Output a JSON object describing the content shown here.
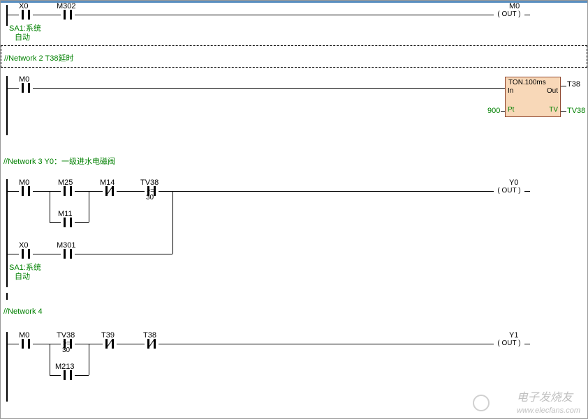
{
  "network1": {
    "x0": "X0",
    "m302": "M302",
    "m0": "M0",
    "out": "( OUT )",
    "sa1_line1": "SA1:系统",
    "sa1_line2": "自动"
  },
  "network2": {
    "title": "//Network 2  T38延时",
    "m0": "M0",
    "fbox_title": "TON.100ms",
    "in": "In",
    "out": "Out",
    "pt": "Pt",
    "tv": "TV",
    "pt_val": "900",
    "t38": "T38",
    "tv38": "TV38"
  },
  "network3": {
    "title": "//Network 3  Y0：一级进水电磁阀",
    "m0": "M0",
    "m25": "M25",
    "m14": "M14",
    "tv38": "TV38",
    "cmp": ">=",
    "val": "30",
    "m11": "M11",
    "x0": "X0",
    "m301": "M301",
    "y0": "Y0",
    "out": "( OUT )",
    "sa1_line1": "SA1:系统",
    "sa1_line2": "自动"
  },
  "network4": {
    "title": "//Network 4",
    "m0": "M0",
    "tv38": "TV38",
    "cmp": ">=",
    "val": "30",
    "t39": "T39",
    "t38": "T38",
    "m213": "M213",
    "y1": "Y1",
    "out": "( OUT )"
  },
  "watermark": {
    "brand": "电子发烧友",
    "url": "www.elecfans.com"
  }
}
